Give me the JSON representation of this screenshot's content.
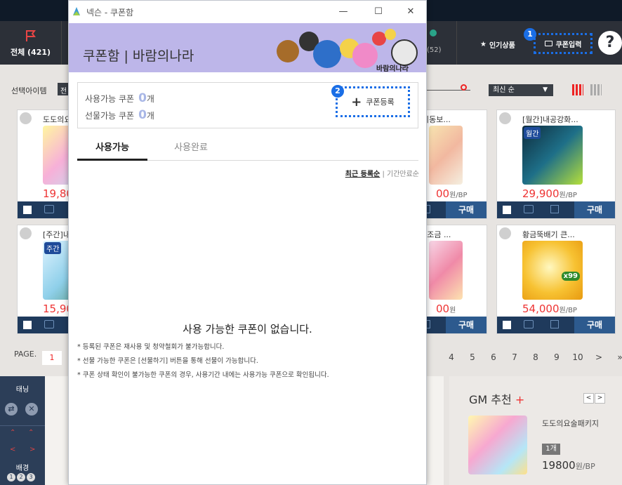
{
  "shop": {
    "nav": {
      "all_label": "전체 (421)",
      "count_52": "(52)",
      "popular_label": "인기상품",
      "coupon_input_label": "쿠폰입력",
      "badge_1": "1",
      "help": "?"
    },
    "filter": {
      "select_label": "선택아이템",
      "select_box_text": "전",
      "sort_selected": "최신 순"
    },
    "cards": [
      {
        "title": "도도의요",
        "price": "19,80",
        "unit": ""
      },
      {
        "title": "비동보...",
        "price": "00",
        "unit": "원/BP"
      },
      {
        "title": "[월간]내공강화...",
        "price": "29,900",
        "unit": "원/BP",
        "tag": "월간"
      },
      {
        "title": "[주간]내",
        "price": "15,90",
        "unit": "",
        "tag": "주간"
      },
      {
        "title": "| 조금 ...",
        "price": "00",
        "unit": "원"
      },
      {
        "title": "황금뚝배기 큰...",
        "price": "54,000",
        "unit": "원/BP",
        "tag": "x99"
      }
    ],
    "buy_label": "구매",
    "pager": {
      "label": "PAGE.",
      "current": "1",
      "pages": [
        "4",
        "5",
        "6",
        "7",
        "8",
        "9",
        "10",
        ">",
        "»"
      ]
    },
    "bottom_left": {
      "tab": "태닝",
      "bg": "배경",
      "nums": [
        "1",
        "2",
        "3"
      ]
    },
    "gm": {
      "heading": "GM 추천",
      "plus": "+",
      "prev": "<",
      "next": ">",
      "item_name": "도도의요술패키지",
      "qty": "1개",
      "price": "19800",
      "unit": "원/BP"
    }
  },
  "popup": {
    "window_title": "넥슨 - 쿠폰함",
    "banner_title": "쿠폰함 | 바람의나라",
    "banner_sign": "바람의나라",
    "available_label": "사용가능 쿠폰",
    "available_count": "0",
    "gift_label": "선물가능 쿠폰",
    "gift_count": "0",
    "count_unit": "개",
    "register_button": "쿠폰등록",
    "badge_2": "2",
    "tabs": [
      "사용가능",
      "사용완료"
    ],
    "sort_recent": "최근 등록순",
    "sort_divider": "|",
    "sort_expiry": "기간만료순",
    "empty_message": "사용 가능한 쿠폰이 없습니다.",
    "notes": [
      "* 등록된 쿠폰은 재사용 및 청약철회가 불가능합니다.",
      "* 선물 가능한 쿠폰은 [선물하기] 버튼을 통해 선물이 가능합니다.",
      "* 쿠폰 상태 확인이 불가능한 쿠폰의 경우, 사용기간 내에는 사용가능 쿠폰으로 확인됩니다."
    ]
  },
  "colors": {
    "nav_bg": "#2c3038",
    "banner_bg": "#bdb6e9",
    "highlight_blue": "#1a6ee6",
    "price_red": "#e33333",
    "buy_blue": "#2d5a8e"
  }
}
